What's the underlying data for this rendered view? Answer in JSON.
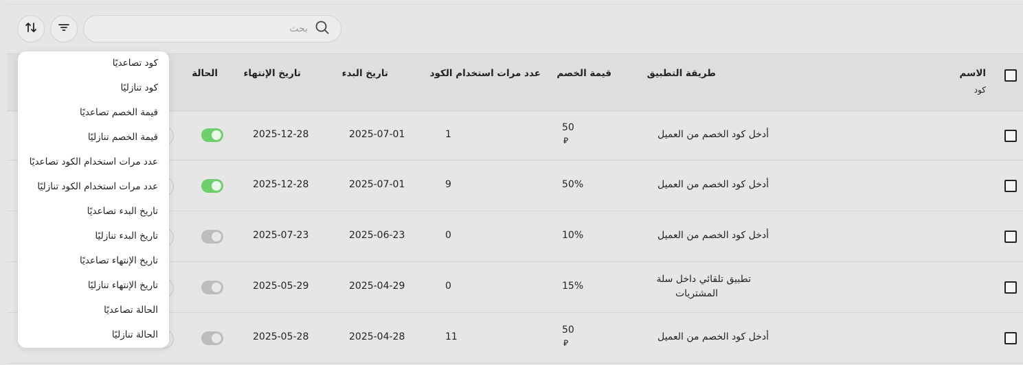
{
  "search": {
    "placeholder": "بحث"
  },
  "table": {
    "headers": {
      "name": "الاسم",
      "name_sub": "كود",
      "method": "طريقة التطبيق",
      "discount": "قيمة الخصم",
      "usage": "عدد مرات استخدام الكود",
      "start": "تاريخ البدء",
      "end": "تاريخ الإنتهاء",
      "status": "الحالة"
    },
    "rows": [
      {
        "method": "أدخل كود الخصم من العميل",
        "discount": "50",
        "currency": "⃁",
        "usage": "1",
        "start": "2025-07-01",
        "end": "2025-12-28",
        "status": "on"
      },
      {
        "method": "أدخل كود الخصم من العميل",
        "discount": "50%",
        "usage": "9",
        "start": "2025-07-01",
        "end": "2025-12-28",
        "status": "on"
      },
      {
        "method": "أدخل كود الخصم من العميل",
        "discount": "10%",
        "usage": "0",
        "start": "2025-06-23",
        "end": "2025-07-23",
        "status": "off"
      },
      {
        "method": "تطبيق تلقائي داخل سلة",
        "method2": "المشتريات",
        "discount": "15%",
        "usage": "0",
        "start": "2025-04-29",
        "end": "2025-05-29",
        "status": "off"
      },
      {
        "method": "أدخل كود الخصم من العميل",
        "discount": "50",
        "currency": "⃁",
        "usage": "11",
        "start": "2025-04-28",
        "end": "2025-05-28",
        "status": "off"
      }
    ]
  },
  "sort_menu": {
    "items": [
      "كود تصاعديًا",
      "كود تنازليًا",
      "قيمة الخصم تصاعديًا",
      "قيمة الخصم تنازليًا",
      "عدد مرات استخدام الكود تصاعديًا",
      "عدد مرات استخدام الكود تنازليًا",
      "تاريخ البدء تصاعديًا",
      "تاريخ البدء تنازليًا",
      "تاريخ الإنتهاء تصاعديًا",
      "تاريخ الإنتهاء تنازليًا",
      "الحالة تصاعديًا",
      "الحالة تنازليًا"
    ]
  },
  "colors": {
    "toggle_on": "#6fcf6b",
    "toggle_off": "#bdbdbd",
    "background": "#e6e6e6"
  }
}
